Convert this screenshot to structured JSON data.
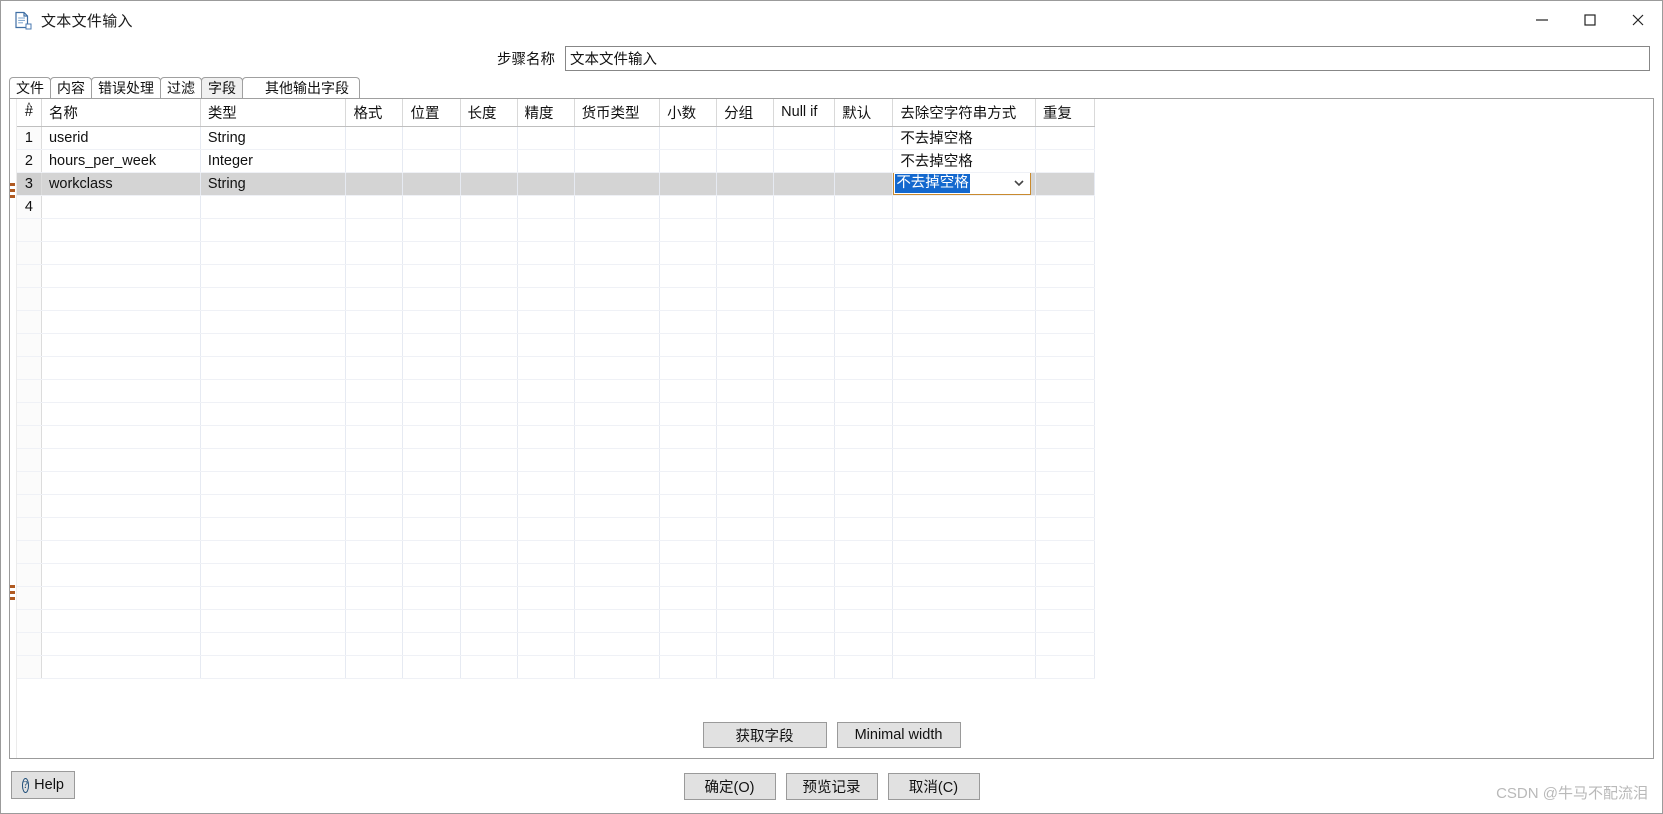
{
  "window": {
    "title": "文本文件输入",
    "icon": "file-document-icon",
    "controls": {
      "minimize": "─",
      "maximize": "□",
      "close": "✕"
    }
  },
  "step": {
    "label": "步骤名称",
    "value": "文本文件输入",
    "placeholder": ""
  },
  "tabs": [
    {
      "label": "文件",
      "selected": false
    },
    {
      "label": "内容",
      "selected": false
    },
    {
      "label": "错误处理",
      "selected": false
    },
    {
      "label": "过滤",
      "selected": false
    },
    {
      "label": "字段",
      "selected": true
    },
    {
      "label": "其他输出字段",
      "selected": false
    }
  ],
  "table": {
    "columns": [
      "#",
      "名称",
      "类型",
      "格式",
      "位置",
      "长度",
      "精度",
      "货币类型",
      "小数",
      "分组",
      "Null if",
      "默认",
      "去除空字符串方式",
      "重复"
    ],
    "rows": [
      {
        "num": "1",
        "name": "userid",
        "type": "String",
        "format": "",
        "position": "",
        "length": "",
        "precision": "",
        "currency": "",
        "decimal": "",
        "group": "",
        "nullif": "",
        "default": "",
        "trim": "不去掉空格",
        "repeat": "",
        "selected": false,
        "editing": false
      },
      {
        "num": "2",
        "name": "hours_per_week",
        "type": "Integer",
        "format": "",
        "position": "",
        "length": "",
        "precision": "",
        "currency": "",
        "decimal": "",
        "group": "",
        "nullif": "",
        "default": "",
        "trim": "不去掉空格",
        "repeat": "",
        "selected": false,
        "editing": false
      },
      {
        "num": "3",
        "name": "workclass",
        "type": "String",
        "format": "",
        "position": "",
        "length": "",
        "precision": "",
        "currency": "",
        "decimal": "",
        "group": "",
        "nullif": "",
        "default": "",
        "trim": "不去掉空格",
        "repeat": "",
        "selected": true,
        "editing": true
      },
      {
        "num": "4",
        "name": "",
        "type": "",
        "format": "",
        "position": "",
        "length": "",
        "precision": "",
        "currency": "",
        "decimal": "",
        "group": "",
        "nullif": "",
        "default": "",
        "trim": "",
        "repeat": "",
        "selected": false,
        "editing": false
      }
    ],
    "empty_row_count": 20,
    "sort_indicator": "˄"
  },
  "mid_buttons": {
    "get_fields": "获取字段",
    "minimal_width": "Minimal width"
  },
  "bottom": {
    "help": "Help",
    "ok": "确定(O)",
    "preview": "预览记录",
    "cancel": "取消(C)"
  },
  "watermark": "CSDN @牛马不配流泪",
  "colors": {
    "selected_row": "#d4d4d4",
    "combo_highlight": "#1368ce",
    "combo_border": "#c98a2e",
    "tab_selected_bg": "#f0f0f0",
    "button_bg": "#e1e1e1",
    "watermark": "#b9b9b9"
  }
}
